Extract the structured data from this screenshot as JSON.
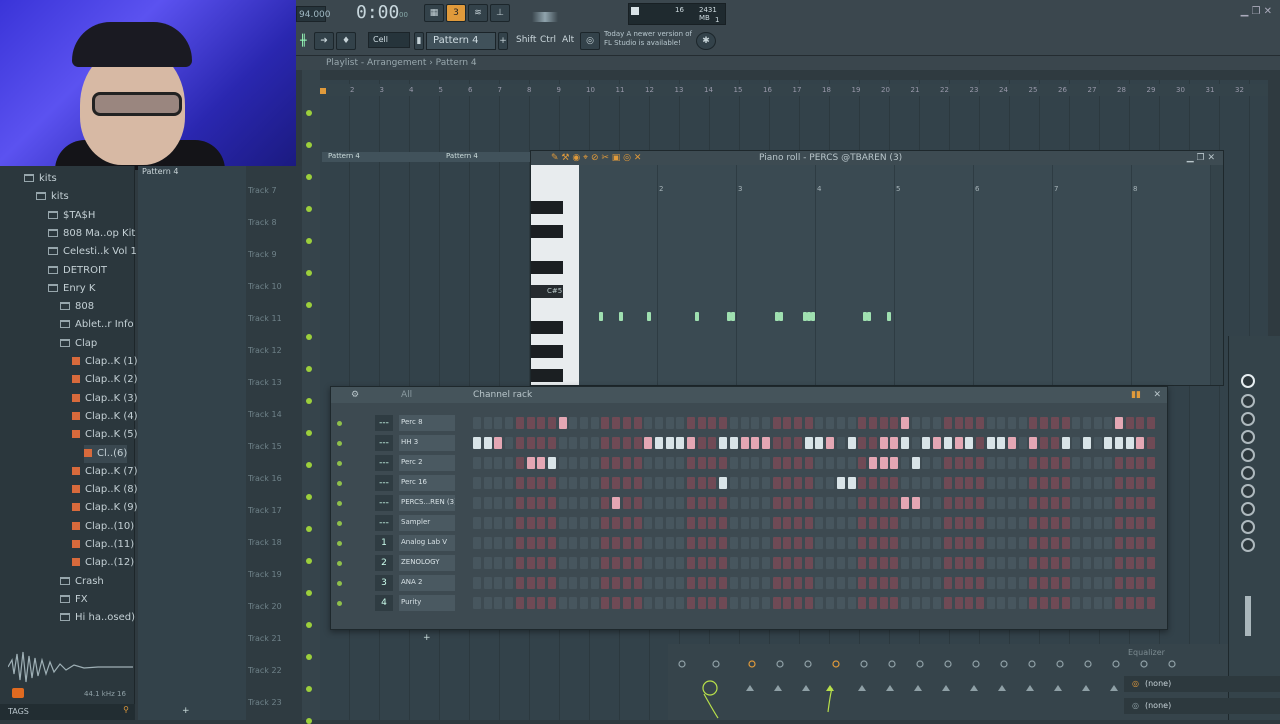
{
  "toolbar": {
    "tempo": "94.000",
    "time": "0:00",
    "time_ms": "00",
    "snap": "Cell",
    "pattern": "Pattern 4",
    "modkeys": [
      "Shift",
      "Ctrl",
      "Alt"
    ],
    "cpu_voices": "16",
    "memory": "2431 MB",
    "cpu_sub": "1",
    "news_line1": "Today   A newer version of",
    "news_line2": "FL Studio is available!",
    "accent_color": "#e09a3b"
  },
  "playlist": {
    "title": "Playlist - Arrangement › Pattern 4",
    "ruler": [
      "2",
      "3",
      "4",
      "5",
      "6",
      "7",
      "8",
      "9",
      "10",
      "11",
      "12",
      "13",
      "14",
      "15",
      "16",
      "17",
      "18",
      "19",
      "20",
      "21",
      "22",
      "23",
      "24",
      "25",
      "26",
      "27",
      "28",
      "29",
      "30",
      "31",
      "32"
    ],
    "clips": [
      "Pattern 4",
      "Pattern 4"
    ],
    "tracks": [
      "Track 7",
      "Track 8",
      "Track 9",
      "Track 10",
      "Track 11",
      "Track 12",
      "Track 13",
      "Track 14",
      "Track 15",
      "Track 16",
      "Track 17",
      "Track 18",
      "Track 19",
      "Track 20",
      "Track 21",
      "Track 22",
      "Track 23"
    ]
  },
  "browser": {
    "items": [
      {
        "label": "kits",
        "type": "folder",
        "indent": 1
      },
      {
        "label": "kits",
        "type": "folder",
        "indent": 2
      },
      {
        "label": "$TA$H",
        "type": "folder",
        "indent": 3
      },
      {
        "label": "808 Ma..op Kit",
        "type": "folder",
        "indent": 3
      },
      {
        "label": "Celesti..k Vol 1",
        "type": "folder",
        "indent": 3
      },
      {
        "label": "DETROIT",
        "type": "folder",
        "indent": 3
      },
      {
        "label": "Enry K",
        "type": "folder",
        "indent": 3
      },
      {
        "label": "808",
        "type": "folder",
        "indent": 4
      },
      {
        "label": "Ablet..r Info",
        "type": "folder",
        "indent": 4
      },
      {
        "label": "Clap",
        "type": "folder",
        "indent": 4
      },
      {
        "label": "Clap..K (1)",
        "type": "file",
        "indent": 5
      },
      {
        "label": "Clap..K (2)",
        "type": "file",
        "indent": 5
      },
      {
        "label": "Clap..K (3)",
        "type": "file",
        "indent": 5
      },
      {
        "label": "Clap..K (4)",
        "type": "file",
        "indent": 5
      },
      {
        "label": "Clap..K (5)",
        "type": "file",
        "indent": 5
      },
      {
        "label": "Cl..(6)",
        "type": "file",
        "indent": 6
      },
      {
        "label": "Clap..K (7)",
        "type": "file",
        "indent": 5
      },
      {
        "label": "Clap..K (8)",
        "type": "file",
        "indent": 5
      },
      {
        "label": "Clap..K (9)",
        "type": "file",
        "indent": 5
      },
      {
        "label": "Clap..(10)",
        "type": "file",
        "indent": 5
      },
      {
        "label": "Clap..(11)",
        "type": "file",
        "indent": 5
      },
      {
        "label": "Clap..(12)",
        "type": "file",
        "indent": 5
      },
      {
        "label": "Crash",
        "type": "folder",
        "indent": 4
      },
      {
        "label": "FX",
        "type": "folder",
        "indent": 4
      },
      {
        "label": "Hi ha..osed)",
        "type": "folder",
        "indent": 4
      }
    ],
    "sample_info": "44.1 kHz 16",
    "tags_label": "TAGS",
    "clip_panel_label": "Pattern 4"
  },
  "piano_roll": {
    "title": "Piano roll - PERCS @TBAREN (3)",
    "key_label": "C#5",
    "bar_numbers": [
      "2",
      "3",
      "4",
      "5",
      "6",
      "7",
      "8"
    ]
  },
  "channel_rack": {
    "title": "Channel rack",
    "filter": "All",
    "channels": [
      {
        "name": "Perc 8",
        "num": "---",
        "steps": "0000000010000000000000000000000000000000100000000000000000001000000000000000000000000000001000000000000000000000000000000000100000000000000000000000001000000000000000000000000000000000"
      },
      {
        "name": "HH 3",
        "num": "---",
        "steps": "wwp0000000000000pwwwp00wwppp000wwp0w00ppw0wpwpw0wwp0p00w0w0wwwp0pp00w00w0pw0w"
      },
      {
        "name": "Perc 2",
        "num": "---",
        "steps": "00000ppw00000000000000000000000000000ppp0w0000000000000000000000000pp000000000000000000000000000000ppp0p00000000000"
      },
      {
        "name": "Perc 16",
        "num": "---",
        "steps": "00000000000000000000000w0000000000ww00000000000000000000000000000000000000000000000000000000000000000000000000000000000000000000000000000000000000000000000000pp000000000000000000000000"
      },
      {
        "name": "PERCS...REN (3)",
        "num": "---",
        "steps": "0000000000000p00000000000000000000000000pp000000000000000000000000000000000000000p0p0000000000w0p0"
      },
      {
        "name": "Sampler",
        "num": "---",
        "steps": ""
      },
      {
        "name": "Analog Lab V",
        "num": "1",
        "steps": ""
      },
      {
        "name": "ZENOLOGY",
        "num": "2",
        "steps": ""
      },
      {
        "name": "ANA 2",
        "num": "3",
        "steps": ""
      },
      {
        "name": "Purity",
        "num": "4",
        "steps": ""
      }
    ]
  },
  "mixer": {
    "eq_label": "Equalizer",
    "slot1": "(none)",
    "slot2": "(none)"
  }
}
